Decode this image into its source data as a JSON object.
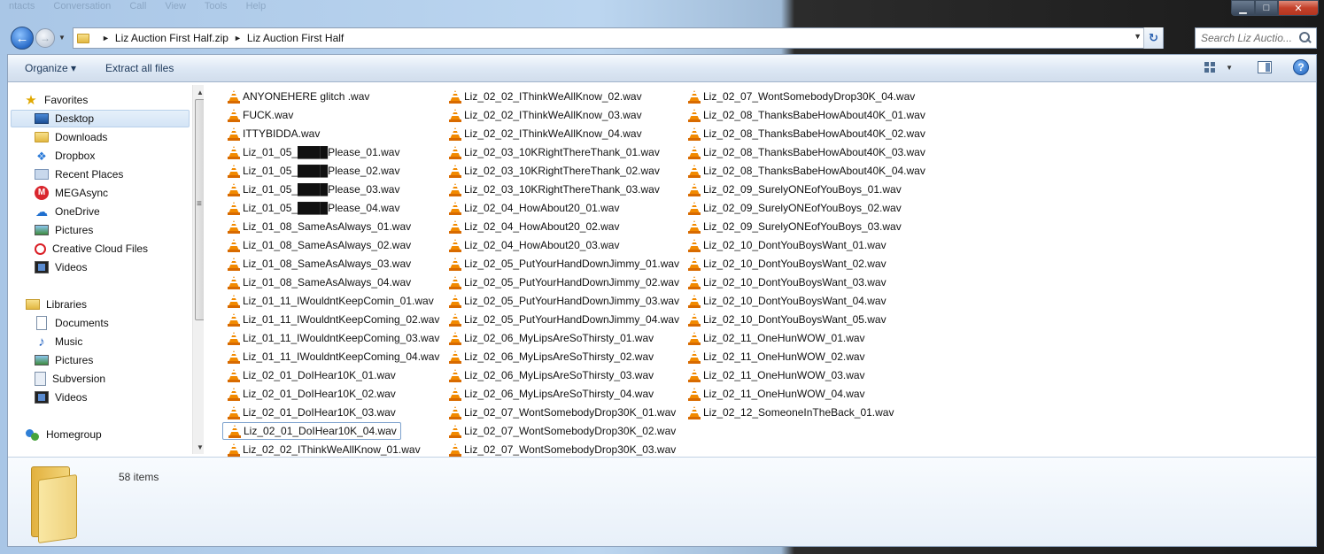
{
  "window": {
    "ghost_menu": [
      "ntacts",
      "Conversation",
      "Call",
      "View",
      "Tools",
      "Help"
    ],
    "minimize": "▁",
    "maximize": "□",
    "close": "✕"
  },
  "nav": {
    "back_glyph": "←",
    "forward_glyph": "→",
    "history_glyph": "▼",
    "breadcrumbs": [
      "Liz Auction First Half.zip",
      "Liz Auction First Half"
    ],
    "crumb_separator": "►",
    "address_dropdown": "▼",
    "refresh_glyph": "↻",
    "search_placeholder": "Search Liz Auctio..."
  },
  "toolbar": {
    "organize": "Organize ▾",
    "extract": "Extract all files",
    "view_dropdown": "▼",
    "help": "?"
  },
  "sidebar": {
    "favorites_label": "Favorites",
    "favorites": [
      {
        "label": "Desktop",
        "icon": "desktop-icon",
        "selected": true
      },
      {
        "label": "Downloads",
        "icon": "downloads-icon"
      },
      {
        "label": "Dropbox",
        "icon": "dropbox-icon"
      },
      {
        "label": "Recent Places",
        "icon": "recent-places-icon"
      },
      {
        "label": "MEGAsync",
        "icon": "mega-icon"
      },
      {
        "label": "OneDrive",
        "icon": "onedrive-icon"
      },
      {
        "label": "Pictures",
        "icon": "pictures-icon"
      },
      {
        "label": "Creative Cloud Files",
        "icon": "creative-cloud-icon"
      },
      {
        "label": "Videos",
        "icon": "videos-icon"
      }
    ],
    "libraries_label": "Libraries",
    "libraries": [
      {
        "label": "Documents",
        "icon": "documents-icon"
      },
      {
        "label": "Music",
        "icon": "music-icon"
      },
      {
        "label": "Pictures",
        "icon": "pictures-icon"
      },
      {
        "label": "Subversion",
        "icon": "subversion-icon"
      },
      {
        "label": "Videos",
        "icon": "videos-icon"
      }
    ],
    "homegroup_label": "Homegroup"
  },
  "files": {
    "column1": [
      "ANYONEHERE glitch .wav",
      "FUCK.wav",
      "ITTYBIDDA.wav",
      "Liz_01_05_████Please_01.wav",
      "Liz_01_05_████Please_02.wav",
      "Liz_01_05_████Please_03.wav",
      "Liz_01_05_████Please_04.wav",
      "Liz_01_08_SameAsAlways_01.wav",
      "Liz_01_08_SameAsAlways_02.wav",
      "Liz_01_08_SameAsAlways_03.wav",
      "Liz_01_08_SameAsAlways_04.wav",
      "Liz_01_11_IWouldntKeepComin_01.wav",
      "Liz_01_11_IWouldntKeepComing_02.wav",
      "Liz_01_11_IWouldntKeepComing_03.wav",
      "Liz_01_11_IWouldntKeepComing_04.wav",
      "Liz_02_01_DoIHear10K_01.wav",
      "Liz_02_01_DoIHear10K_02.wav",
      "Liz_02_01_DoIHear10K_03.wav",
      "Liz_02_01_DoIHear10K_04.wav",
      "Liz_02_02_IThinkWeAllKnow_01.wav"
    ],
    "column2": [
      "Liz_02_02_IThinkWeAllKnow_02.wav",
      "Liz_02_02_IThinkWeAllKnow_03.wav",
      "Liz_02_02_IThinkWeAllKnow_04.wav",
      "Liz_02_03_10KRightThereThank_01.wav",
      "Liz_02_03_10KRightThereThank_02.wav",
      "Liz_02_03_10KRightThereThank_03.wav",
      "Liz_02_04_HowAbout20_01.wav",
      "Liz_02_04_HowAbout20_02.wav",
      "Liz_02_04_HowAbout20_03.wav",
      "Liz_02_05_PutYourHandDownJimmy_01.wav",
      "Liz_02_05_PutYourHandDownJimmy_02.wav",
      "Liz_02_05_PutYourHandDownJimmy_03.wav",
      "Liz_02_05_PutYourHandDownJimmy_04.wav",
      "Liz_02_06_MyLipsAreSoThirsty_01.wav",
      "Liz_02_06_MyLipsAreSoThirsty_02.wav",
      "Liz_02_06_MyLipsAreSoThirsty_03.wav",
      "Liz_02_06_MyLipsAreSoThirsty_04.wav",
      "Liz_02_07_WontSomebodyDrop30K_01.wav",
      "Liz_02_07_WontSomebodyDrop30K_02.wav",
      "Liz_02_07_WontSomebodyDrop30K_03.wav"
    ],
    "column3": [
      "Liz_02_07_WontSomebodyDrop30K_04.wav",
      "Liz_02_08_ThanksBabeHowAbout40K_01.wav",
      "Liz_02_08_ThanksBabeHowAbout40K_02.wav",
      "Liz_02_08_ThanksBabeHowAbout40K_03.wav",
      "Liz_02_08_ThanksBabeHowAbout40K_04.wav",
      "Liz_02_09_SurelyONEofYouBoys_01.wav",
      "Liz_02_09_SurelyONEofYouBoys_02.wav",
      "Liz_02_09_SurelyONEofYouBoys_03.wav",
      "Liz_02_10_DontYouBoysWant_01.wav",
      "Liz_02_10_DontYouBoysWant_02.wav",
      "Liz_02_10_DontYouBoysWant_03.wav",
      "Liz_02_10_DontYouBoysWant_04.wav",
      "Liz_02_10_DontYouBoysWant_05.wav",
      "Liz_02_11_OneHunWOW_01.wav",
      "Liz_02_11_OneHunWOW_02.wav",
      "Liz_02_11_OneHunWOW_03.wav",
      "Liz_02_11_OneHunWOW_04.wav",
      "Liz_02_12_SomeoneInTheBack_01.wav"
    ],
    "focused_file": "Liz_02_01_DoIHear10K_04.wav"
  },
  "details": {
    "item_count": "58 items"
  },
  "colors": {
    "accent": "#1e395b",
    "file_icon": "#f28a00",
    "selection": "#d4e4f6"
  }
}
